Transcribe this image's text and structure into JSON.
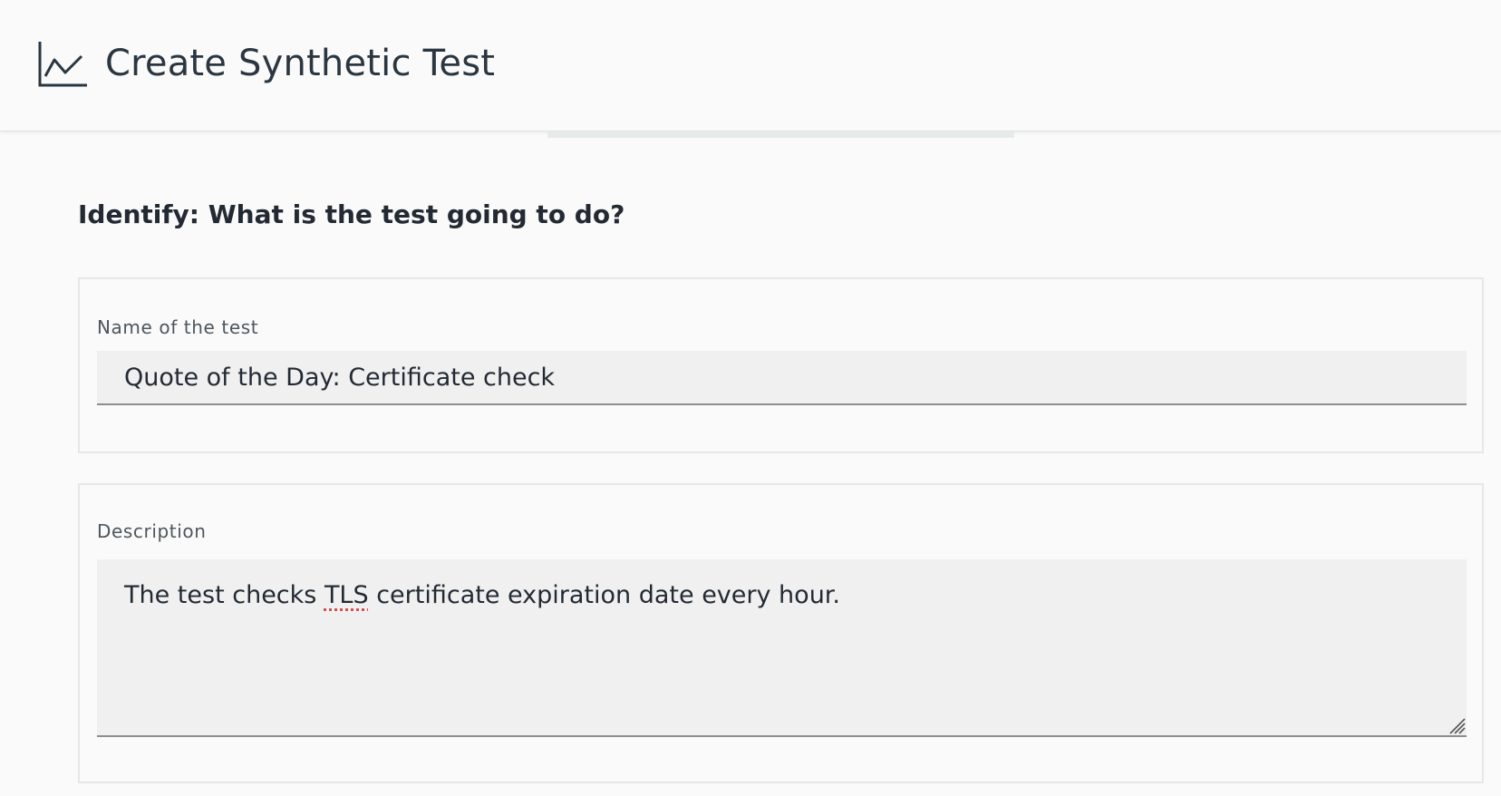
{
  "header": {
    "title": "Create Synthetic Test",
    "icon": "chart-line-icon"
  },
  "section": {
    "title": "Identify: What is the test going to do?"
  },
  "name_field": {
    "label": "Name of the test",
    "value": "Quote of the Day: Certificate check"
  },
  "description_field": {
    "label": "Description",
    "value_before": "The test checks ",
    "value_flagged": "TLS",
    "value_after": " certificate expiration date every hour."
  },
  "colors": {
    "background": "#f9faf9",
    "input_fill": "#f0f0f0",
    "input_border": "#8d8d8d",
    "text": "#232a33"
  }
}
